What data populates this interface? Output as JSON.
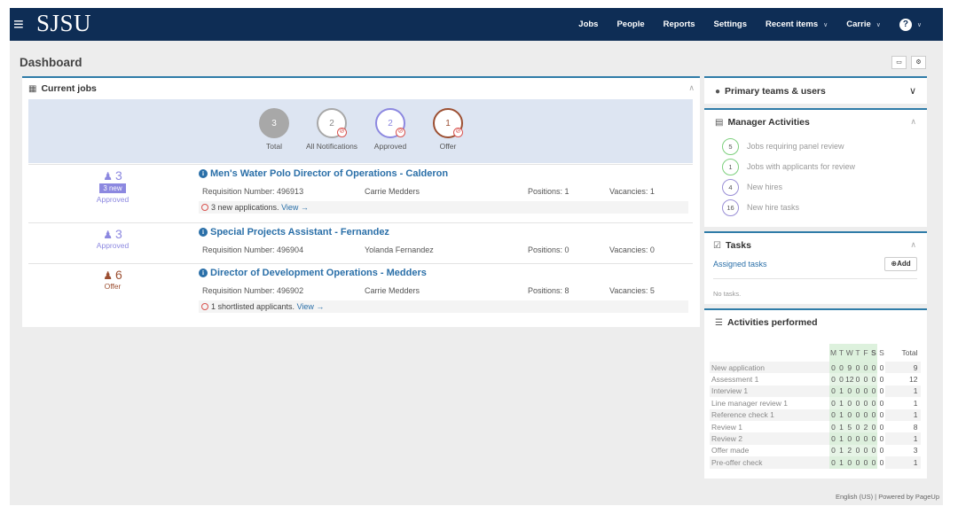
{
  "header": {
    "logo": "SJSU",
    "nav": [
      {
        "label": "Jobs",
        "caret": false
      },
      {
        "label": "People",
        "caret": false
      },
      {
        "label": "Reports",
        "caret": false
      },
      {
        "label": "Settings",
        "caret": false
      },
      {
        "label": "Recent items",
        "caret": true
      },
      {
        "label": "Carrie",
        "caret": true
      }
    ],
    "help_icon": "?"
  },
  "page": {
    "title": "Dashboard"
  },
  "current_jobs": {
    "title": "Current jobs",
    "summary": [
      {
        "value": "3",
        "label": "Total",
        "color": "#a8a8a8",
        "filled": true
      },
      {
        "value": "2",
        "label": "All Notifications",
        "color": "#a8a8a8",
        "filled": false
      },
      {
        "value": "2",
        "label": "Approved",
        "color": "#8c88e0",
        "filled": false
      },
      {
        "value": "1",
        "label": "Offer",
        "color": "#9c4f32",
        "filled": false
      }
    ],
    "jobs": [
      {
        "count": "3",
        "badge": "3 new",
        "status": "Approved",
        "status_color": "#8c88e0",
        "title": "Men's Water Polo Director of Operations - Calderon",
        "requisition": "Requisition Number: 496913",
        "manager": "Carrie Medders",
        "positions": "Positions: 1",
        "vacancies": "Vacancies: 1",
        "note": "3 new applications.",
        "note_link": "View →"
      },
      {
        "count": "3",
        "badge": "",
        "status": "Approved",
        "status_color": "#8c88e0",
        "title": "Special Projects Assistant - Fernandez",
        "requisition": "Requisition Number: 496904",
        "manager": "Yolanda Fernandez",
        "positions": "Positions: 0",
        "vacancies": "Vacancies: 0",
        "note": "",
        "note_link": ""
      },
      {
        "count": "6",
        "badge": "",
        "status": "Offer",
        "status_color": "#9c4f32",
        "title": "Director of Development Operations - Medders",
        "requisition": "Requisition Number: 496902",
        "manager": "Carrie Medders",
        "positions": "Positions: 8",
        "vacancies": "Vacancies: 5",
        "note": "1 shortlisted applicants.",
        "note_link": "View →"
      }
    ]
  },
  "primary_teams": {
    "title": "Primary teams & users"
  },
  "manager_activities": {
    "title": "Manager Activities",
    "items": [
      {
        "count": "5",
        "label": "Jobs requiring panel review",
        "color": "#7ed07e"
      },
      {
        "count": "1",
        "label": "Jobs with applicants for review",
        "color": "#7ed07e"
      },
      {
        "count": "4",
        "label": "New hires",
        "color": "#9a8fd6"
      },
      {
        "count": "16",
        "label": "New hire tasks",
        "color": "#9a8fd6"
      }
    ]
  },
  "tasks": {
    "title": "Tasks",
    "assigned_link": "Assigned tasks",
    "add_label": "Add",
    "empty": "No tasks."
  },
  "activities_performed": {
    "title": "Activities performed",
    "days": [
      "M",
      "T",
      "W",
      "T",
      "F",
      "S",
      "S"
    ],
    "total_label": "Total",
    "rows": [
      {
        "label": "New application",
        "values": [
          "0",
          "0",
          "9",
          "0",
          "0",
          "0",
          "0"
        ],
        "total": "9"
      },
      {
        "label": "Assessment 1",
        "values": [
          "0",
          "0",
          "12",
          "0",
          "0",
          "0",
          "0"
        ],
        "total": "12"
      },
      {
        "label": "Interview 1",
        "values": [
          "0",
          "1",
          "0",
          "0",
          "0",
          "0",
          "0"
        ],
        "total": "1"
      },
      {
        "label": "Line manager review 1",
        "values": [
          "0",
          "1",
          "0",
          "0",
          "0",
          "0",
          "0"
        ],
        "total": "1"
      },
      {
        "label": "Reference check 1",
        "values": [
          "0",
          "1",
          "0",
          "0",
          "0",
          "0",
          "0"
        ],
        "total": "1"
      },
      {
        "label": "Review 1",
        "values": [
          "0",
          "1",
          "5",
          "0",
          "2",
          "0",
          "0"
        ],
        "total": "8"
      },
      {
        "label": "Review 2",
        "values": [
          "0",
          "1",
          "0",
          "0",
          "0",
          "0",
          "0"
        ],
        "total": "1"
      },
      {
        "label": "Offer made",
        "values": [
          "0",
          "1",
          "2",
          "0",
          "0",
          "0",
          "0"
        ],
        "total": "3"
      },
      {
        "label": "Pre-offer check",
        "values": [
          "0",
          "1",
          "0",
          "0",
          "0",
          "0",
          "0"
        ],
        "total": "1"
      }
    ]
  },
  "footer": {
    "text": "English (US) | Powered by PageUp"
  }
}
